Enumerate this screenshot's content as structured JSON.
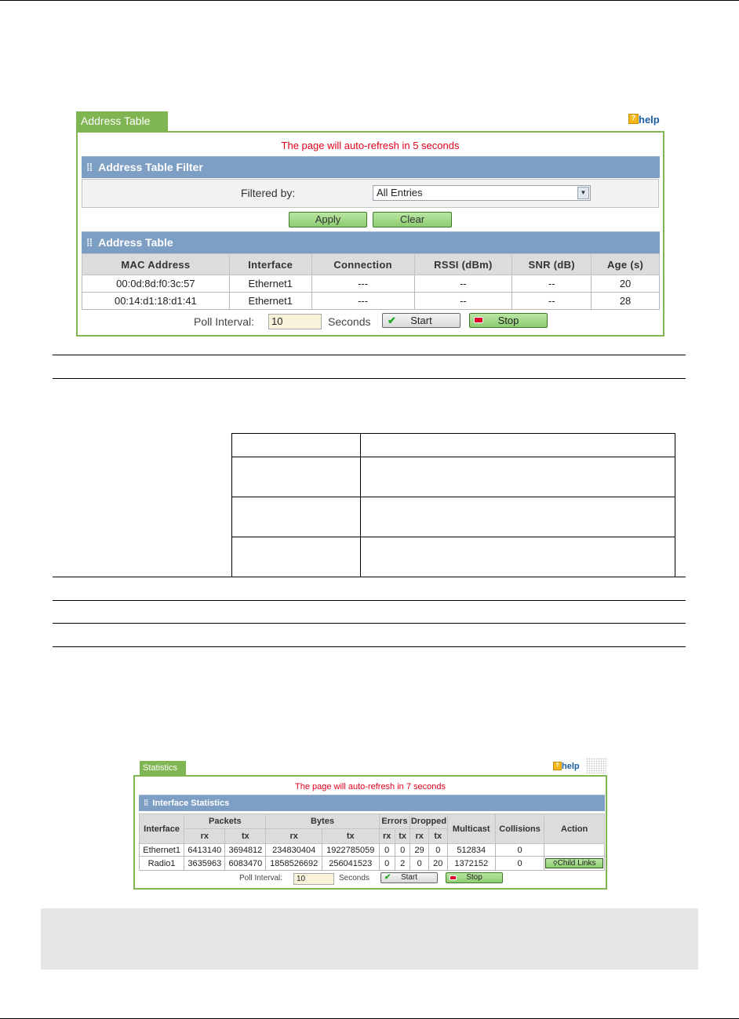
{
  "top_rule": true,
  "address_panel": {
    "tab_label": "Address Table",
    "help_label": "help",
    "help_icon": "help-question-icon",
    "refresh_text": "The page will auto-refresh in 5 seconds",
    "filter_section_title": "Address Table Filter",
    "filter_label": "Filtered by:",
    "filter_value": "All Entries",
    "apply_label": "Apply",
    "clear_label": "Clear",
    "table_section_title": "Address Table",
    "columns": [
      "MAC Address",
      "Interface",
      "Connection",
      "RSSI (dBm)",
      "SNR (dB)",
      "Age (s)"
    ],
    "rows": [
      [
        "00:0d:8d:f0:3c:57",
        "Ethernet1",
        "---",
        "--",
        "--",
        "20"
      ],
      [
        "00:14:d1:18:d1:41",
        "Ethernet1",
        "---",
        "--",
        "--",
        "28"
      ]
    ],
    "poll_label": "Poll Interval:",
    "poll_value": "10",
    "seconds_label": "Seconds",
    "start_label": "Start",
    "stop_label": "Stop"
  },
  "stats_panel": {
    "tab_label": "Statistics",
    "help_label": "help",
    "refresh_text": "The page will auto-refresh in 7 seconds",
    "section_title": "Interface Statistics",
    "headers": {
      "interface": "Interface",
      "packets": "Packets",
      "bytes": "Bytes",
      "errors": "Errors",
      "dropped": "Dropped",
      "multicast": "Multicast",
      "collisions": "Collisions",
      "action": "Action",
      "rx": "rx",
      "tx": "tx"
    },
    "rows": [
      {
        "interface": "Ethernet1",
        "packets_rx": "6413140",
        "packets_tx": "3694812",
        "bytes_rx": "234830404",
        "bytes_tx": "1922785059",
        "errors_rx": "0",
        "errors_tx": "0",
        "dropped_rx": "29",
        "dropped_tx": "0",
        "multicast": "512834",
        "collisions": "0",
        "action": ""
      },
      {
        "interface": "Radio1",
        "packets_rx": "3635963",
        "packets_tx": "6083470",
        "bytes_rx": "1858526692",
        "bytes_tx": "256041523",
        "errors_rx": "0",
        "errors_tx": "2",
        "dropped_rx": "0",
        "dropped_tx": "20",
        "multicast": "1372152",
        "collisions": "0",
        "action": "Child Links"
      }
    ],
    "poll_label": "Poll Interval:",
    "poll_value": "10",
    "seconds_label": "Seconds",
    "start_label": "Start",
    "stop_label": "Stop"
  },
  "colors": {
    "panel_green": "#7fb552",
    "section_blue": "#7d9fc4",
    "refresh_red": "#e0001b",
    "help_blue": "#1a5d9e"
  }
}
